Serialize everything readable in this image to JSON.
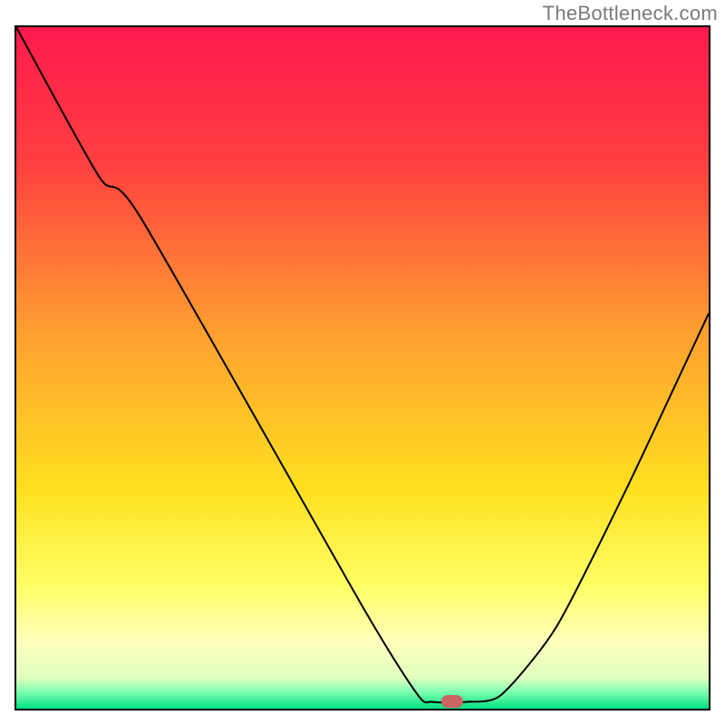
{
  "watermark": "TheBottleneck.com",
  "chart_data": {
    "type": "line",
    "title": "",
    "xlabel": "",
    "ylabel": "",
    "xlim": [
      0,
      100
    ],
    "ylim": [
      0,
      100
    ],
    "x": [
      0,
      12,
      18,
      50,
      58,
      60,
      65,
      70,
      78,
      88,
      100
    ],
    "values": [
      100,
      78,
      72,
      15,
      2,
      1,
      1,
      2,
      12,
      32,
      58
    ],
    "grid": false,
    "legend": false,
    "background_gradient": {
      "direction": "vertical",
      "stops": [
        {
          "offset": 0.0,
          "color": "#ff1a4d"
        },
        {
          "offset": 0.2,
          "color": "#ff4040"
        },
        {
          "offset": 0.45,
          "color": "#ffa030"
        },
        {
          "offset": 0.68,
          "color": "#ffe020"
        },
        {
          "offset": 0.82,
          "color": "#ffff66"
        },
        {
          "offset": 0.9,
          "color": "#ffffbb"
        },
        {
          "offset": 0.955,
          "color": "#e0ffc0"
        },
        {
          "offset": 0.975,
          "color": "#80ffb0"
        },
        {
          "offset": 1.0,
          "color": "#00e080"
        }
      ]
    },
    "marker": {
      "x": 63,
      "y": 1,
      "color": "#cc6666"
    }
  }
}
